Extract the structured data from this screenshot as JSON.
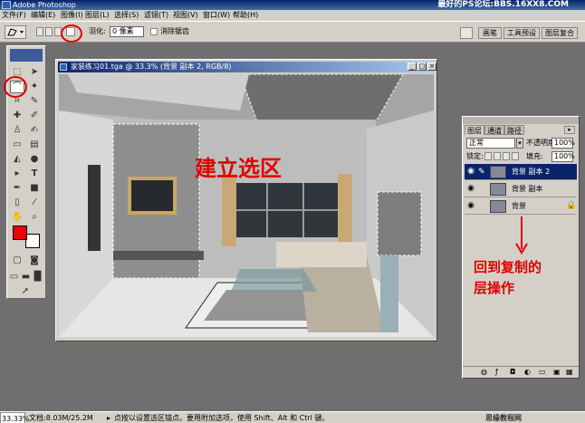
{
  "window": {
    "title": "Adobe Photoshop",
    "watermark": "最好的PS论坛:BBS.16XX8.COM"
  },
  "menu": [
    "文件(F)",
    "编辑(E)",
    "图像(I)",
    "图层(L)",
    "选择(S)",
    "滤镜(T)",
    "视图(V)",
    "窗口(W)",
    "帮助(H)"
  ],
  "options": {
    "feather_label": "羽化:",
    "feather_value": "0 像素",
    "antialias_label": "消除锯齿",
    "tabs": [
      "画笔",
      "工具预设",
      "图层复合"
    ]
  },
  "document": {
    "title": "家装练习01.tga @ 33.3% (背景 副本 2, RGB/8)",
    "annotation": "建立选区"
  },
  "layers_panel": {
    "tabs": [
      "图层",
      "通道",
      "路径"
    ],
    "blend_mode": "正常",
    "opacity_label": "不透明度:",
    "opacity_value": "100%",
    "lock_label": "锁定:",
    "fill_label": "填充:",
    "fill_value": "100%",
    "layers": [
      {
        "name": "背景 副本 2",
        "selected": true
      },
      {
        "name": "背景 副本",
        "selected": false
      },
      {
        "name": "背景",
        "selected": false
      }
    ],
    "annotation_line1": "回到复制的",
    "annotation_line2": "层操作"
  },
  "status": {
    "zoom": "33.33%",
    "doc": "文档:8.03M/25.2M",
    "hint": "点按以设置选区锚点。要用附加选项，使用 Shift、Alt 和 Ctrl 键。",
    "site": "思缘教程网 www.missyuan.com"
  }
}
